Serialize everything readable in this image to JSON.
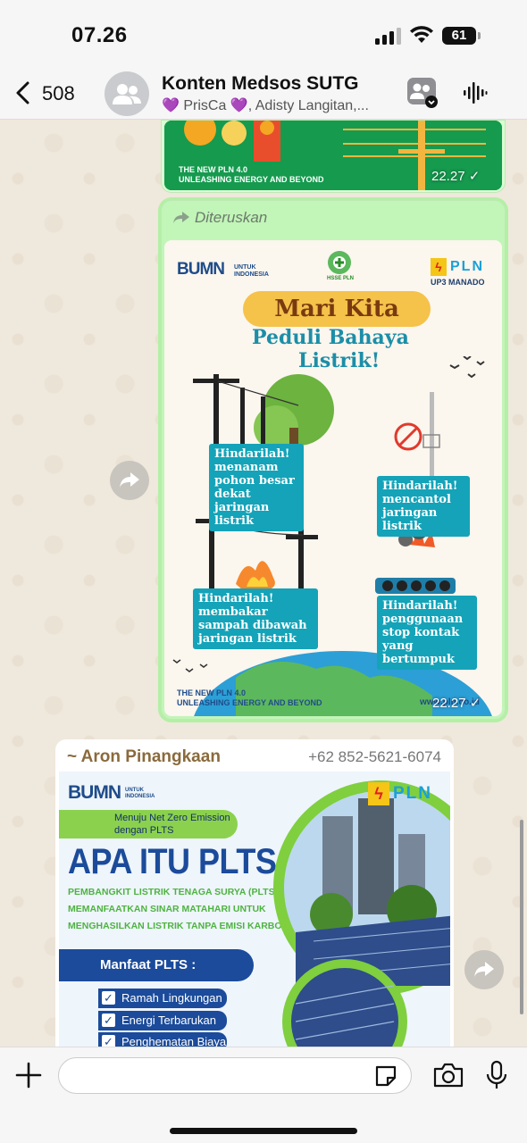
{
  "status_bar": {
    "time": "07.26",
    "battery": "61"
  },
  "header": {
    "back_count": "508",
    "title": "Konten Medsos SUTG",
    "subtitle": "💜 PrisCa 💜, Adisty Langitan,..."
  },
  "message1": {
    "slogan_line1": "THE NEW PLN 4.0",
    "slogan_line2": "UNLEASHING ENERGY AND BEYOND",
    "time": "22.27 ✓"
  },
  "message2": {
    "forwarded_label": "Diteruskan",
    "poster": {
      "bumn_logo": "BUMN",
      "bumn_sub": "UNTUK INDONESIA",
      "hsse": "HSSE PLN",
      "pln": "PLN",
      "up3": "UP3 MANADO",
      "title": "Mari Kita",
      "subtitle_line1": "Peduli Bahaya",
      "subtitle_line2": "Listrik!",
      "tag1": "Hindarilah! menanam pohon besar dekat jaringan listrik",
      "tag2": "Hindarilah! mencantol jaringan listrik",
      "tag3": "Hindarilah! membakar sampah dibawah jaringan listrik",
      "tag4": "Hindarilah! penggunaan stop kontak yang bertumpuk",
      "slogan_line1": "THE NEW PLN 4.0",
      "slogan_line2": "UNLEASHING ENERGY AND BEYOND",
      "web": "www.pln.co.id"
    },
    "time": "22.27 ✓"
  },
  "message3": {
    "sender": "~ Aron Pinangkaan",
    "phone": "+62 852-5621-6074",
    "poster": {
      "bumn_logo": "BUMN",
      "bumn_sub": "UNTUK INDONESIA",
      "pln": "PLN",
      "netzero": "Menuju Net Zero Emission dengan PLTS",
      "title": "APA ITU PLTS ?",
      "desc_line1": "PEMBANGKIT LISTRIK TENAGA SURYA (PLTS)",
      "desc_line2": "MEMANFAATKAN SINAR MATAHARI UNTUK",
      "desc_line3": "MENGHASILKAN LISTRIK TANPA EMISI KARBON",
      "manfaat": "Manfaat PLTS :",
      "benefits": [
        "Ramah Lingkungan",
        "Energi Terbarukan",
        "Penghematan Biaya"
      ]
    }
  },
  "input": {
    "placeholder": ""
  },
  "colors": {
    "outgoing": "#d9fdd3",
    "accent_teal": "#14a3b8",
    "pln_blue": "#1b4b9a",
    "pln_green": "#8bd14e"
  }
}
